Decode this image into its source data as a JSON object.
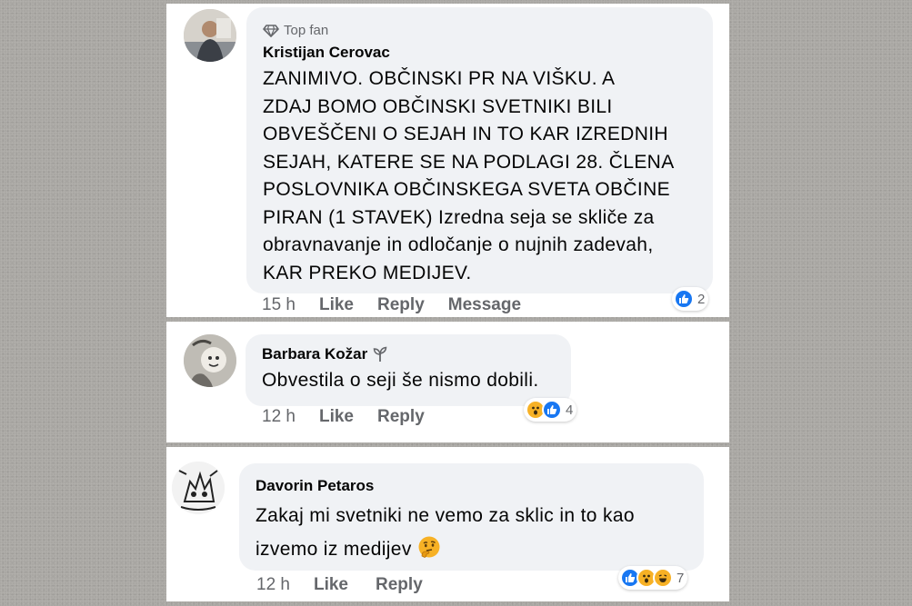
{
  "comments": [
    {
      "badge": "Top fan",
      "author": "Kristijan Cerovac",
      "text_lines": [
        "ZANIMIVO. OBČINSKI PR NA VIŠKU. A",
        "ZDAJ BOMO OBČINSKI SVETNIKI BILI",
        "OBVEŠČENI O SEJAH IN TO KAR IZREDNIH",
        "SEJAH, KATERE SE NA PODLAGI 28. ČLENA",
        "POSLOVNIKA OBČINSKEGA SVETA OBČINE",
        "PIRAN (1 STAVEK) Izredna seja se skliče za",
        "obravnavanje in odločanje o nujnih zadevah,",
        "KAR PREKO MEDIJEV."
      ],
      "time": "15 h",
      "actions": [
        "Like",
        "Reply",
        "Message"
      ],
      "reaction_count": "2"
    },
    {
      "author": "Barbara Kožar",
      "author_icon": "sprout-icon",
      "text_lines": [
        "Obvestila o seji še nismo dobili."
      ],
      "time": "12 h",
      "actions": [
        "Like",
        "Reply"
      ],
      "reaction_count": "4"
    },
    {
      "author": "Davorin Petaros",
      "text_lines": [
        "Zakaj mi svetniki ne vemo za sklic in to kao",
        "izvemo iz medijev"
      ],
      "trailing_emoji": "thinking-face-emoji",
      "time": "12 h",
      "actions": [
        "Like",
        "Reply"
      ],
      "reaction_count": "7"
    }
  ],
  "colors": {
    "bubble": "#f0f2f5",
    "secondary_text": "#65676b",
    "like_blue": "#1877f2",
    "emoji_yellow": "#f7b125"
  }
}
